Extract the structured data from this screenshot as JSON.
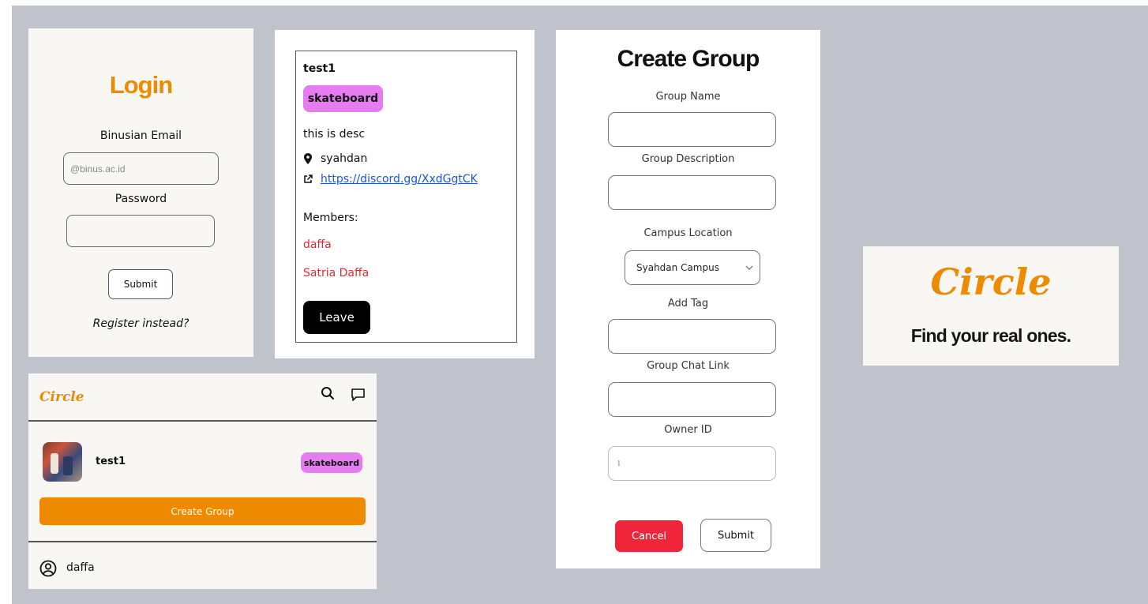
{
  "login": {
    "title": "Login",
    "email_label": "Binusian Email",
    "email_placeholder": "@binus.ac.id",
    "password_label": "Password",
    "submit": "Submit",
    "register": "Register instead?"
  },
  "detail": {
    "title": "test1",
    "tag": "skateboard",
    "description": "this is desc",
    "location": "syahdan",
    "link": "https://discord.gg/XxdGgtCK",
    "members_label": "Members:",
    "members": [
      "daffa",
      "Satria Daffa"
    ],
    "leave": "Leave"
  },
  "create": {
    "title": "Create Group",
    "name_label": "Group Name",
    "desc_label": "Group Description",
    "campus_label": "Campus Location",
    "campus_value": "Syahdan Campus",
    "tag_label": "Add Tag",
    "chat_label": "Group Chat Link",
    "owner_label": "Owner ID",
    "owner_value": "1",
    "cancel": "Cancel",
    "submit": "Submit"
  },
  "logo": {
    "wordmark": "Circle",
    "slogan": "Find your real ones."
  },
  "home": {
    "logo": "Circle",
    "group_name": "test1",
    "group_tag": "skateboard",
    "create_button": "Create Group",
    "username": "daffa"
  },
  "colors": {
    "brand_orange": "#ee8a00",
    "tag_purple": "#e57cf0",
    "member_red": "#e8262f",
    "cancel_red": "#f0253a",
    "link_blue": "#1a55e6"
  }
}
